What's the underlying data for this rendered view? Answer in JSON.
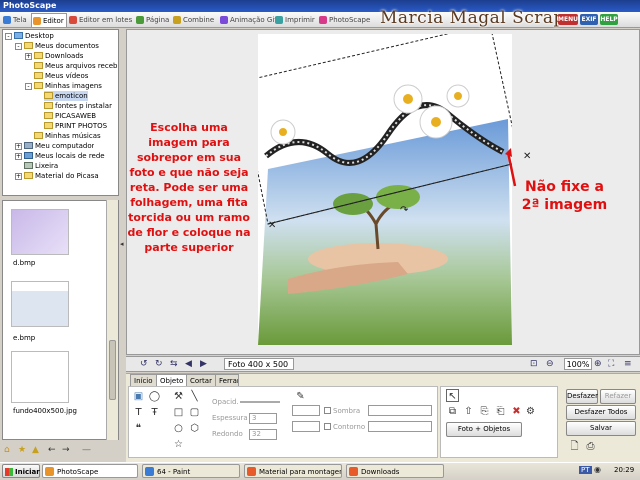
{
  "app": {
    "title": "PhotoScape"
  },
  "brand": "Marcia Magal Scraps",
  "top_badges": [
    "MENU",
    "EXIF",
    "HELP"
  ],
  "tabs": [
    {
      "label": "Tela",
      "color": "#3a7bd5"
    },
    {
      "label": "Editor",
      "color": "#e8942a"
    },
    {
      "label": "Editor em lotes",
      "color": "#d84a3a"
    },
    {
      "label": "Página",
      "color": "#4a9a3a"
    },
    {
      "label": "Combine",
      "color": "#c8a020"
    },
    {
      "label": "Animação Gif",
      "color": "#7a4ad8"
    },
    {
      "label": "Imprimir",
      "color": "#3aa0a0"
    },
    {
      "label": "PhotoScape",
      "color": "#d83a8a"
    }
  ],
  "tree": {
    "items": [
      {
        "label": "Desktop",
        "expander": "-"
      },
      {
        "label": "Meus documentos",
        "expander": "-"
      },
      {
        "label": "Downloads",
        "expander": "+"
      },
      {
        "label": "Meus arquivos recebidos",
        "expander": ""
      },
      {
        "label": "Meus vídeos",
        "expander": ""
      },
      {
        "label": "Minhas imagens",
        "expander": "-"
      },
      {
        "label": "emoticon",
        "expander": ""
      },
      {
        "label": "fontes p instalar",
        "expander": ""
      },
      {
        "label": "PICASAWEB",
        "expander": ""
      },
      {
        "label": "PRINT PHOTOS",
        "expander": ""
      },
      {
        "label": "Minhas músicas",
        "expander": ""
      },
      {
        "label": "Meu computador",
        "expander": "+"
      },
      {
        "label": "Meus locais de rede",
        "expander": "+"
      },
      {
        "label": "Lixeira",
        "expander": ""
      },
      {
        "label": "Material do Picasa",
        "expander": "+"
      }
    ]
  },
  "thumbnails": [
    {
      "label": "d.bmp"
    },
    {
      "label": "e.bmp"
    },
    {
      "label": "fundo400x500.jpg"
    }
  ],
  "instructions_left": "Escolha uma imagem para sobrepor em sua foto e que não seja reta. Pode ser uma folhagem, uma fita torcida ou um ramo de flor e coloque na parte superior",
  "instructions_right": "Não fixe a 2ª imagem",
  "zoombar": {
    "photo_info": "Foto 400 x 500",
    "zoom": "100%"
  },
  "panel": {
    "tabs": [
      "Início",
      "Objeto",
      "Cortar",
      "Ferramentas"
    ],
    "active_tab": "Objeto",
    "labels": {
      "opacity": "Opacid.",
      "thickness": "Espessura",
      "roundness": "Redondo",
      "thickness_value": "3",
      "roundness_value": "32",
      "shadow": "Sombra",
      "contour": "Contorno"
    },
    "photo_objects_button": "Foto + Objetos",
    "undo": "Desfazer",
    "redo": "Refazer",
    "undo_all": "Desfazer Todos",
    "save": "Salvar"
  },
  "taskbar": {
    "start": "Iniciar",
    "tasks": [
      {
        "label": "PhotoScape",
        "color": "#e8942a"
      },
      {
        "label": "64 - Paint",
        "color": "#3a7bd5"
      },
      {
        "label": "Material para montagens...",
        "color": "#e85a2a"
      },
      {
        "label": "Downloads",
        "color": "#e85a2a"
      }
    ],
    "tray": "PT",
    "clock": "20:29"
  }
}
